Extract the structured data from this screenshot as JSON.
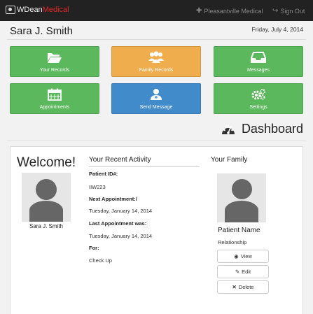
{
  "brand": {
    "name_part1": "WDean",
    "name_part2": "Medical",
    "accent_color": "#e02a2a"
  },
  "nav": {
    "location": {
      "icon": "plus-icon",
      "label": "Pleasantville Medical"
    },
    "signout": {
      "icon": "signout-icon",
      "label": "Sign Out"
    }
  },
  "header": {
    "user_name": "Sara J. Smith",
    "date": "Friday, July 4, 2014"
  },
  "tiles": [
    {
      "icon": "folder-open-icon",
      "label": "Your Records",
      "color": "#5cb85c"
    },
    {
      "icon": "users-icon",
      "label": "Family Records",
      "color": "#f0ad4e"
    },
    {
      "icon": "inbox-icon",
      "label": "Messages",
      "color": "#5cb85c"
    },
    {
      "icon": "calendar-icon",
      "label": "Appointments",
      "color": "#5cb85c"
    },
    {
      "icon": "user-md-icon",
      "label": "Send Message",
      "color": "#428bca"
    },
    {
      "icon": "gears-icon",
      "label": "Settings",
      "color": "#5cb85c"
    }
  ],
  "dashboard": {
    "icon": "dashboard-gauge-icon",
    "title": "Dashboard"
  },
  "welcome": {
    "heading": "Welcome!",
    "caption": "Sara J. Smith"
  },
  "activity": {
    "title": "Your Recent Activity",
    "patient_id_label": "Patient ID#:",
    "patient_id": "IIW223",
    "next_label": "Next Appointment:/",
    "next_value": "Tuesday, January 14, 2014",
    "last_label": "Last Appointment was:",
    "last_value": "Tuesday, January 14, 2014",
    "for_label": "For:",
    "for_value": "Check Up"
  },
  "family": {
    "title": "Your Family",
    "member_name": "Patient Name",
    "relationship": "Relationship",
    "view_label": "View",
    "edit_label": "Edit",
    "delete_label": "Delete"
  }
}
